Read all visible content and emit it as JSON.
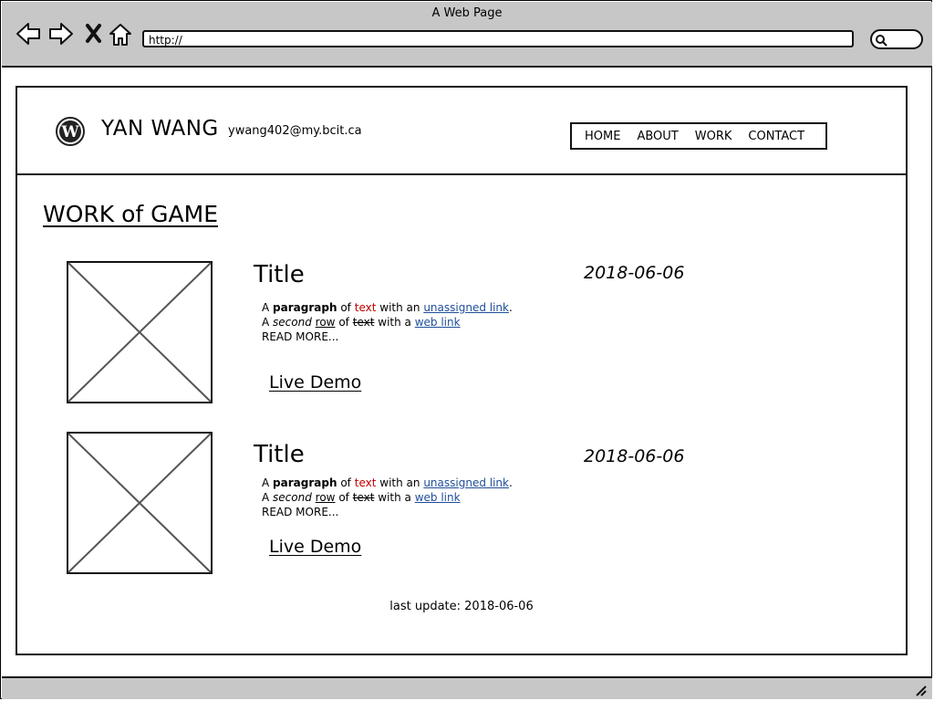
{
  "window": {
    "title": "A Web Page"
  },
  "browser": {
    "url": "http://"
  },
  "header": {
    "name": "YAN WANG",
    "email": "ywang402@my.bcit.ca",
    "menu": [
      "HOME",
      "ABOUT",
      "WORK",
      "CONTACT"
    ]
  },
  "page_title": "WORK of GAME",
  "cards": [
    {
      "title": "Title",
      "date": "2018-06-06",
      "line1": {
        "a": "A",
        "bold": "paragraph",
        "of": "of",
        "red": "text",
        "with": "with an",
        "link": "unassigned link",
        "end": "."
      },
      "line2": {
        "a": "A",
        "italic": "second",
        "under": "row",
        "of": "of",
        "strike": "text",
        "with": "with a",
        "link": "web link"
      },
      "read_more": "READ MORE...",
      "demo": "Live Demo"
    },
    {
      "title": "Title",
      "date": "2018-06-06",
      "line1": {
        "a": "A",
        "bold": "paragraph",
        "of": "of",
        "red": "text",
        "with": "with an",
        "link": "unassigned link",
        "end": "."
      },
      "line2": {
        "a": "A",
        "italic": "second",
        "under": "row",
        "of": "of",
        "strike": "text",
        "with": "with a",
        "link": "web link"
      },
      "read_more": "READ MORE...",
      "demo": "Live Demo"
    }
  ],
  "footer": {
    "text": "last update: 2018-06-06"
  },
  "colors": {
    "chrome": "#c7c7c7",
    "red_text": "#c00000",
    "link": "#1f4e99"
  }
}
